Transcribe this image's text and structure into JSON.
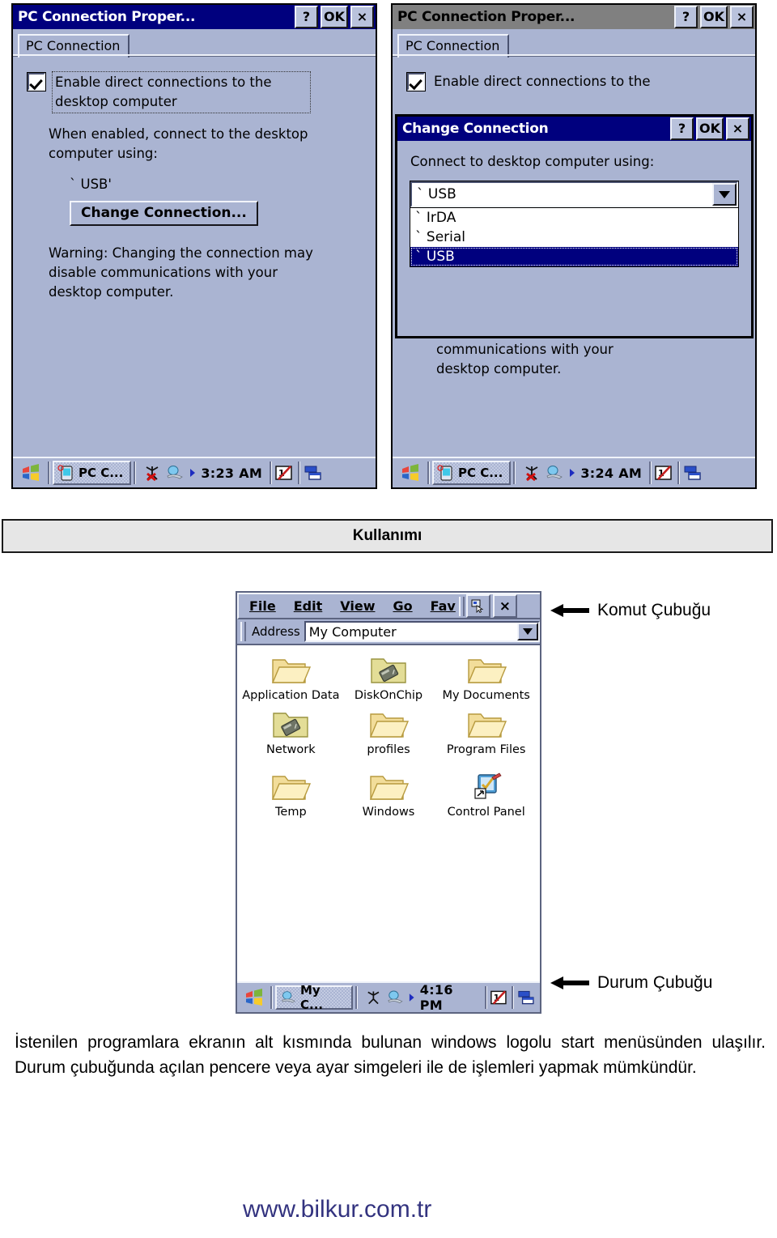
{
  "colors": {
    "title_active": "#00007e",
    "title_inactive": "#808080",
    "window_face": "#aab4d2",
    "selection": "#00007e",
    "band_fill": "#e6e6e6",
    "footer_text": "#33337f"
  },
  "window_left": {
    "title": "PC Connection Proper...",
    "buttons": {
      "help": "?",
      "ok": "OK",
      "close": "×"
    },
    "tab": "PC Connection",
    "checkbox": {
      "label": "Enable direct connections to the desktop computer",
      "checked": true
    },
    "when_enabled_text": "When enabled, connect to the desktop computer using:",
    "current_connection": "` USB'",
    "change_button": "Change Connection...",
    "warning": "Warning: Changing the connection may disable communications with your desktop computer.",
    "taskbar": {
      "task_label": "PC C...",
      "time": "3:23 AM"
    }
  },
  "window_right": {
    "title": "PC Connection Proper...",
    "buttons": {
      "help": "?",
      "ok": "OK",
      "close": "×"
    },
    "tab": "PC Connection",
    "checkbox": {
      "label": "Enable direct connections to the",
      "checked": true
    },
    "occluded_text_1": "your desktop computer.",
    "occluded_text_2": "communications with your desktop computer.",
    "taskbar": {
      "task_label": "PC C...",
      "time": "3:24 AM"
    }
  },
  "dialog_change_connection": {
    "title": "Change Connection",
    "buttons": {
      "help": "?",
      "ok": "OK",
      "close": "×"
    },
    "prompt": "Connect to desktop computer using:",
    "combo_value": "` USB",
    "options": [
      "` IrDA",
      "` Serial",
      "` USB"
    ],
    "selected_option": "` USB",
    "selected_index": 2
  },
  "section_band": {
    "title": "Kullanımı"
  },
  "explorer": {
    "menus": [
      {
        "label": "File",
        "accel": "F"
      },
      {
        "label": "Edit",
        "accel": "E"
      },
      {
        "label": "View",
        "accel": "V"
      },
      {
        "label": "Go",
        "accel": "G"
      },
      {
        "label": "Fav",
        "accel": "v"
      }
    ],
    "close_label": "×",
    "address_label": "Address",
    "address_value": "My Computer",
    "items": [
      {
        "label": "Application Data",
        "icon": "folder"
      },
      {
        "label": "DiskOnChip",
        "icon": "folder-storage"
      },
      {
        "label": "My Documents",
        "icon": "folder"
      },
      {
        "label": "Network",
        "icon": "folder-storage"
      },
      {
        "label": "profiles",
        "icon": "folder"
      },
      {
        "label": "Program Files",
        "icon": "folder"
      },
      {
        "label": "Temp",
        "icon": "folder"
      },
      {
        "label": "Windows",
        "icon": "folder"
      },
      {
        "label": "Control Panel",
        "icon": "control-panel-shortcut"
      }
    ],
    "taskbar": {
      "task_label": "My C...",
      "time": "4:16 PM"
    }
  },
  "callouts": {
    "command_bar": "Komut Çubuğu",
    "status_bar": "Durum Çubuğu"
  },
  "paragraph": "İstenilen programlara ekranın alt kısmında bulunan windows logolu start menüsünden ulaşılır. Durum çubuğunda açılan pencere veya ayar simgeleri ile de işlemleri yapmak mümkündür.",
  "footer": "www.bilkur.com.tr"
}
